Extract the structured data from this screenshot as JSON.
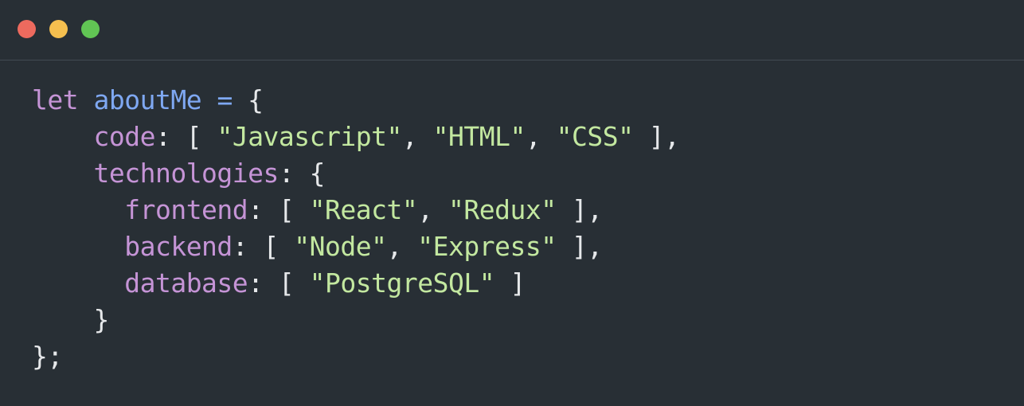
{
  "window": {
    "buttons": [
      {
        "name": "close",
        "color": "#ed6a5e"
      },
      {
        "name": "minimize",
        "color": "#f5bf4f"
      },
      {
        "name": "maximize",
        "color": "#61c554"
      }
    ]
  },
  "colors": {
    "background": "#282f35",
    "keyword": "#c594d6",
    "identifier": "#7fa8f2",
    "property": "#c594d6",
    "string": "#c3e8a0",
    "punctuation": "#e6e8ea"
  },
  "code": {
    "lines": [
      {
        "indent": "",
        "tokens": [
          {
            "type": "keyword",
            "text": "let"
          },
          {
            "type": "punctuation",
            "text": " "
          },
          {
            "type": "identifier",
            "text": "aboutMe"
          },
          {
            "type": "punctuation",
            "text": " "
          },
          {
            "type": "identifier",
            "text": "="
          },
          {
            "type": "punctuation",
            "text": " {"
          }
        ]
      },
      {
        "indent": "    ",
        "tokens": [
          {
            "type": "property",
            "text": "code"
          },
          {
            "type": "punctuation",
            "text": ": [ "
          },
          {
            "type": "string",
            "text": "\"Javascript\""
          },
          {
            "type": "punctuation",
            "text": ", "
          },
          {
            "type": "string",
            "text": "\"HTML\""
          },
          {
            "type": "punctuation",
            "text": ", "
          },
          {
            "type": "string",
            "text": "\"CSS\""
          },
          {
            "type": "punctuation",
            "text": " ],"
          }
        ]
      },
      {
        "indent": "    ",
        "tokens": [
          {
            "type": "property",
            "text": "technologies"
          },
          {
            "type": "punctuation",
            "text": ": {"
          }
        ]
      },
      {
        "indent": "      ",
        "tokens": [
          {
            "type": "property",
            "text": "frontend"
          },
          {
            "type": "punctuation",
            "text": ": [ "
          },
          {
            "type": "string",
            "text": "\"React\""
          },
          {
            "type": "punctuation",
            "text": ", "
          },
          {
            "type": "string",
            "text": "\"Redux\""
          },
          {
            "type": "punctuation",
            "text": " ],"
          }
        ]
      },
      {
        "indent": "      ",
        "tokens": [
          {
            "type": "property",
            "text": "backend"
          },
          {
            "type": "punctuation",
            "text": ": [ "
          },
          {
            "type": "string",
            "text": "\"Node\""
          },
          {
            "type": "punctuation",
            "text": ", "
          },
          {
            "type": "string",
            "text": "\"Express\""
          },
          {
            "type": "punctuation",
            "text": " ],"
          }
        ]
      },
      {
        "indent": "      ",
        "tokens": [
          {
            "type": "property",
            "text": "database"
          },
          {
            "type": "punctuation",
            "text": ": [ "
          },
          {
            "type": "string",
            "text": "\"PostgreSQL\""
          },
          {
            "type": "punctuation",
            "text": " ]"
          }
        ]
      },
      {
        "indent": "    ",
        "tokens": [
          {
            "type": "punctuation",
            "text": "}"
          }
        ]
      },
      {
        "indent": "",
        "tokens": [
          {
            "type": "punctuation",
            "text": "};"
          }
        ]
      }
    ]
  }
}
